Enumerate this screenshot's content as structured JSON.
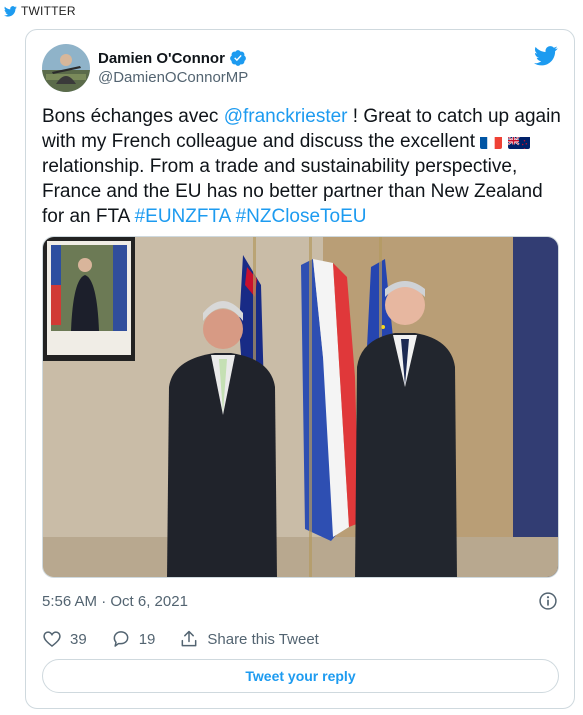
{
  "source": {
    "label": "TWITTER",
    "icon": "twitter-bird-icon"
  },
  "author": {
    "display_name": "Damien O'Connor",
    "handle": "@DamienOConnorMP",
    "verified": true
  },
  "tweet": {
    "text_1": "Bons échanges avec ",
    "mention": "@franckriester",
    "text_2": " ! Great to catch up again with my French colleague and discuss the excellent ",
    "text_3": " relationship. From a trade and sustainability perspective, France and the EU has no better partner than New Zealand for an FTA ",
    "hashtag_1": "#EUNZFTA",
    "hashtag_2": "#NZCloseToEU",
    "flags": [
      "france-flag-icon",
      "new-zealand-flag-icon"
    ]
  },
  "timestamp": "5:56 AM · Oct 6, 2021",
  "actions": {
    "likes": "39",
    "replies": "19",
    "share_label": "Share this Tweet"
  },
  "reply_button_label": "Tweet your reply",
  "colors": {
    "accent": "#1d9bf0",
    "secondary_text": "#536471",
    "border": "#cfd9de"
  }
}
